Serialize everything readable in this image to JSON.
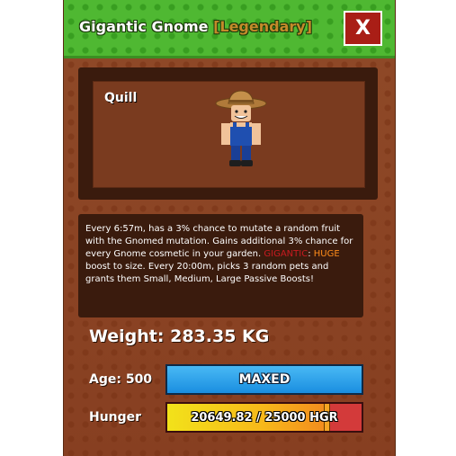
{
  "header": {
    "title": "Gigantic Gnome",
    "rarity": "[Legendary]",
    "close_label": "X"
  },
  "pet": {
    "name": "Quill",
    "image": "gnome-avatar-icon"
  },
  "description": {
    "part1": "Every 6:57m, has a 3% chance to mutate a random fruit with the Gnomed mutation. Gains additional 3% chance for every Gnome cosmetic in your garden.",
    "gigantic_label": "GIGANTIC",
    "colon": ": ",
    "huge_label": "HUGE",
    "part2": " boost to size. Every 20:00m, picks 3 random pets and grants them Small, Medium, Large Passive Boosts!"
  },
  "weight": {
    "label": "Weight: 283.35 KG"
  },
  "age": {
    "label": "Age: 500",
    "bar_text": "MAXED",
    "progress": 1.0
  },
  "hunger": {
    "label": "Hunger",
    "bar_text": "20649.82 / 25000 HGR",
    "current": 20649.82,
    "max": 25000
  },
  "colors": {
    "grass": "#4fb832",
    "dirt": "#8a4424",
    "close_button": "#a91e16",
    "rarity": "#c48a2a",
    "gigantic": "#c81b20",
    "huge": "#ff8c1a",
    "age_bar": "#1a8ee0",
    "hunger_fill": "#f7b81a",
    "hunger_empty": "#d33a3a"
  }
}
